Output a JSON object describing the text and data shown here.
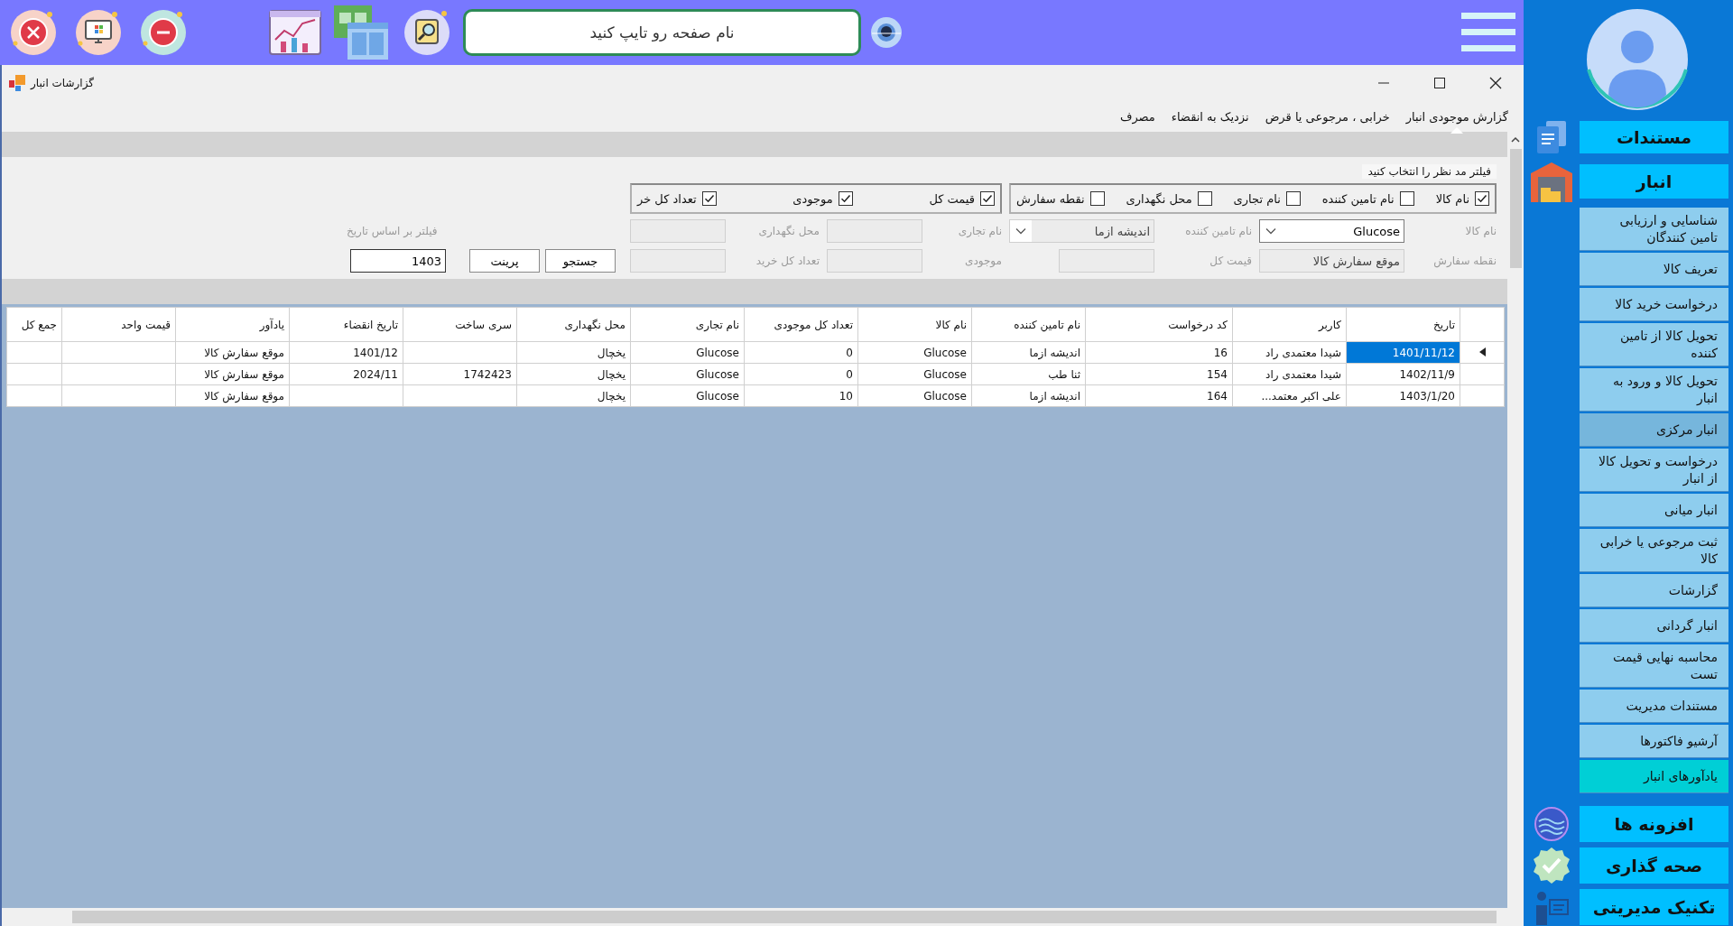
{
  "top_bar": {
    "search": {
      "placeholder": "نام صفحه رو تایپ کنید"
    }
  },
  "window": {
    "title": "گزارشات انبار"
  },
  "menu": [
    {
      "label": "گزارش موجودی انبار",
      "selected": true
    },
    {
      "label": "خرابی ، مرجوعی یا قرض",
      "selected": false
    },
    {
      "label": "نزدیک به انقضاء",
      "selected": false
    },
    {
      "label": "مصرف",
      "selected": false
    }
  ],
  "filter": {
    "group_label": "فیلتر مد نظر را انتخاب کنید",
    "checkbox_group_1": [
      {
        "label": "نام کالا",
        "checked": true
      },
      {
        "label": "نام تامین کننده",
        "checked": false
      },
      {
        "label": "نام تجاری",
        "checked": false
      },
      {
        "label": "محل نگهداری",
        "checked": false
      },
      {
        "label": "نقطه سفارش",
        "checked": false
      }
    ],
    "checkbox_group_2": [
      {
        "label": "قیمت کل",
        "checked": true
      },
      {
        "label": "موجودی",
        "checked": true
      },
      {
        "label": "تعداد کل خر",
        "checked": true
      }
    ],
    "row_1": [
      {
        "label": "نام کالا",
        "kind": "combo",
        "value": "Glucose",
        "disabled": false
      },
      {
        "label": "نام تامین کننده",
        "kind": "combo",
        "value": "اندیشه ازما",
        "disabled": true
      },
      {
        "label": "نام تجاری",
        "kind": "text",
        "disabled": true
      },
      {
        "label": "محل نگهداری",
        "kind": "text",
        "disabled": true
      }
    ],
    "row_2": [
      {
        "label": "نقطه سفارش",
        "kind": "text",
        "value": "موقع سفارش کالا",
        "disabled": true
      },
      {
        "label": "قیمت کل",
        "kind": "text",
        "disabled": true
      },
      {
        "label": "موجودی",
        "kind": "text",
        "disabled": true
      },
      {
        "label": "تعداد کل خرید",
        "kind": "text",
        "disabled": true
      }
    ],
    "date_filter": {
      "label": "فیلتر بر اساس تاریخ",
      "value": "1403"
    },
    "buttons": [
      "جستجو",
      "پرینت"
    ]
  },
  "table": {
    "columns": [
      "تاریخ",
      "کاربر",
      "کد درخواست",
      "نام تامین کننده",
      "نام کالا",
      "تعداد کل موجودی",
      "نام تجاری",
      "محل نگهداری",
      "سری ساخت",
      "تاریخ انقضاء",
      "یادآور",
      "قیمت واحد",
      "جمع کل"
    ],
    "rows": [
      {
        "selected": true,
        "cells": [
          "1401/11/12",
          "شیدا معتمدی راد",
          "16",
          "اندیشه ازما",
          "Glucose",
          "0",
          "Glucose",
          "یخچال",
          "",
          "1401/12",
          "موقع سفارش کالا",
          "",
          ""
        ]
      },
      {
        "selected": false,
        "cells": [
          "1402/11/9",
          "شیدا معتمدی راد",
          "154",
          "ثنا طب",
          "Glucose",
          "0",
          "Glucose",
          "یخچال",
          "1742423",
          "2024/11",
          "موقع سفارش کالا",
          "",
          ""
        ]
      },
      {
        "selected": false,
        "cells": [
          "1403/1/20",
          "علی اکبر معتمد...",
          "164",
          "اندیشه ازما",
          "Glucose",
          "10",
          "Glucose",
          "یخچال",
          "",
          "",
          "موقع سفارش کالا",
          "",
          ""
        ]
      }
    ]
  },
  "sidebar": {
    "top_items": [
      "مستندات",
      "انبار"
    ],
    "sub_items": [
      {
        "label": "شناسایی و ارزیابی تامین کنندگان",
        "hovered": false,
        "selected": false
      },
      {
        "label": "تعریف کالا",
        "hovered": false,
        "selected": false
      },
      {
        "label": "درخواست خرید کالا",
        "hovered": false,
        "selected": false
      },
      {
        "label": "تحویل کالا از تامین کننده",
        "hovered": false,
        "selected": false
      },
      {
        "label": "تحویل کالا و ورود به انبار",
        "hovered": false,
        "selected": false
      },
      {
        "label": "انبار مرکزی",
        "hovered": true,
        "selected": false
      },
      {
        "label": "درخواست و تحویل کالا از انبار",
        "hovered": false,
        "selected": false
      },
      {
        "label": "انبار میانی",
        "hovered": false,
        "selected": false
      },
      {
        "label": "ثبت مرجوعی یا خرابی کالا",
        "hovered": false,
        "selected": false
      },
      {
        "label": "گزارشات",
        "hovered": false,
        "selected": false
      },
      {
        "label": "انبار گردانی",
        "hovered": false,
        "selected": false
      },
      {
        "label": "محاسبه نهایی قیمت تست",
        "hovered": false,
        "selected": false
      },
      {
        "label": "مستندات مدیریت",
        "hovered": false,
        "selected": false
      },
      {
        "label": "آرشیو فاکتورها",
        "hovered": false,
        "selected": false
      },
      {
        "label": "یادآورهای انبار",
        "hovered": false,
        "selected": true
      }
    ],
    "bottom_items": [
      "افزونه ها",
      "صحه گذاری",
      "تکنیک مدیریتی"
    ]
  }
}
